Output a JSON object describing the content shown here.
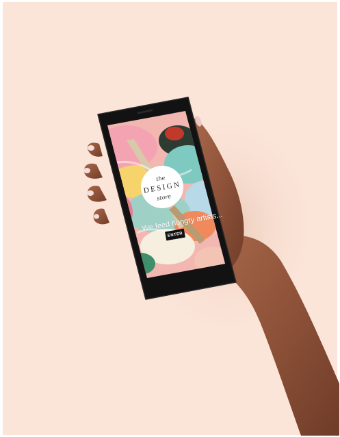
{
  "app": {
    "brand": {
      "line1": "the",
      "line2": "DESIGN",
      "line3": "store"
    },
    "tagline": "We feed hungry artists...",
    "enter_label": "ENTER"
  },
  "colors": {
    "background": "#fbe4d8",
    "phone_body": "#121212",
    "screen_accent_pink": "#f4a3b2",
    "screen_accent_teal": "#7ec9c0",
    "button": "#111111"
  }
}
